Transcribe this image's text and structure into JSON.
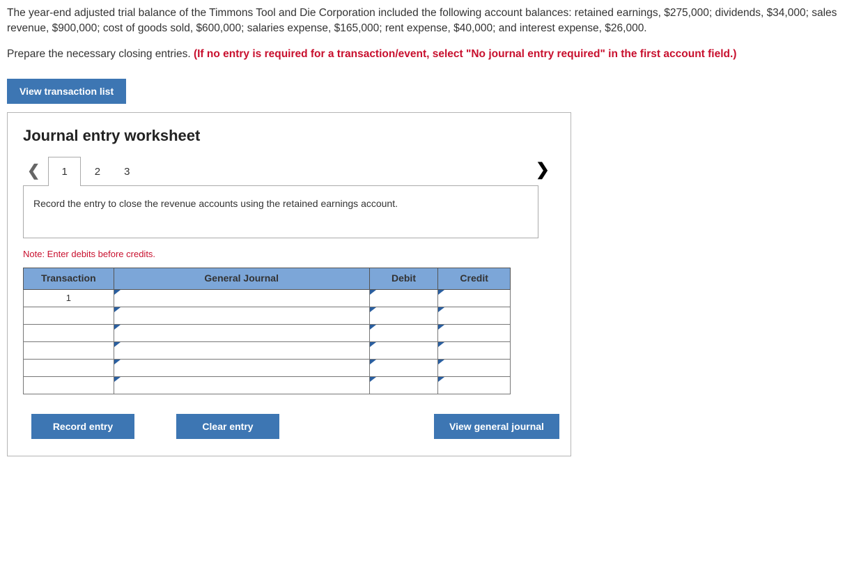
{
  "problem": {
    "para1": "The year-end adjusted trial balance of the Timmons Tool and Die Corporation included the following account balances: retained earnings, $275,000; dividends, $34,000; sales revenue, $900,000; cost of goods sold, $600,000; salaries expense, $165,000; rent expense, $40,000; and interest expense, $26,000.",
    "para2a": "Prepare the necessary closing entries. ",
    "para2b": "(If no entry is required for a transaction/event, select \"No journal entry required\" in the first account field.)"
  },
  "buttons": {
    "view_list": "View transaction list",
    "record": "Record entry",
    "clear": "Clear entry",
    "view_journal": "View general journal"
  },
  "worksheet": {
    "title": "Journal entry worksheet",
    "tabs": [
      "1",
      "2",
      "3"
    ],
    "instruction": "Record the entry to close the revenue accounts using the retained earnings account.",
    "note": "Note: Enter debits before credits.",
    "headers": {
      "transaction": "Transaction",
      "general_journal": "General Journal",
      "debit": "Debit",
      "credit": "Credit"
    },
    "rows": [
      {
        "transaction": "1",
        "gj": "",
        "debit": "",
        "credit": ""
      },
      {
        "transaction": "",
        "gj": "",
        "debit": "",
        "credit": ""
      },
      {
        "transaction": "",
        "gj": "",
        "debit": "",
        "credit": ""
      },
      {
        "transaction": "",
        "gj": "",
        "debit": "",
        "credit": ""
      },
      {
        "transaction": "",
        "gj": "",
        "debit": "",
        "credit": ""
      },
      {
        "transaction": "",
        "gj": "",
        "debit": "",
        "credit": ""
      }
    ]
  }
}
